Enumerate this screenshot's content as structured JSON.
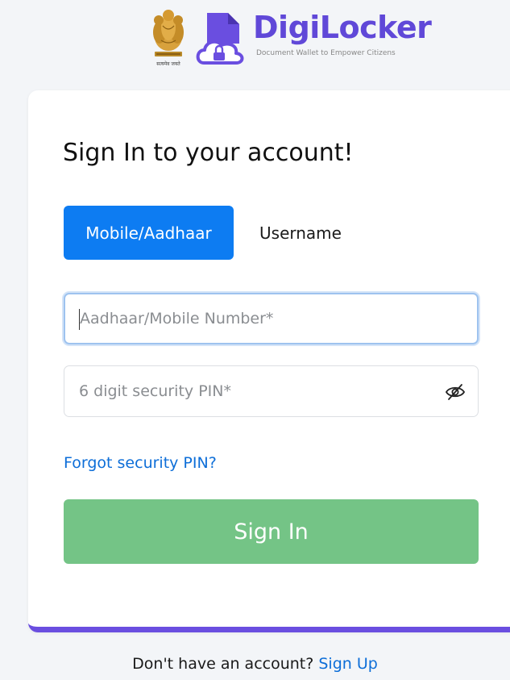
{
  "brand": {
    "name": "DigiLocker",
    "tagline": "Document Wallet to Empower Citizens",
    "emblem_caption": "सत्यमेव जयते",
    "colors": {
      "brand_purple": "#6048d8",
      "card_accent": "#6a4ee0"
    }
  },
  "signin_card": {
    "title": "Sign In to your account!",
    "tabs": [
      {
        "label": "Mobile/Aadhaar",
        "active": true
      },
      {
        "label": "Username",
        "active": false
      }
    ],
    "mobile_field": {
      "placeholder": "Aadhaar/Mobile Number*",
      "value": ""
    },
    "pin_field": {
      "placeholder": "6 digit security PIN*",
      "value": "",
      "toggle_icon": "eye-slash-icon"
    },
    "forgot_link": "Forgot security PIN?",
    "signin_button": "Sign In",
    "colors": {
      "tab_active": "#0d7cf2",
      "link": "#0d6ed8",
      "signin_button": "#74c486"
    }
  },
  "footer": {
    "prompt": "Don't have an account?",
    "signup_link": "Sign Up"
  }
}
